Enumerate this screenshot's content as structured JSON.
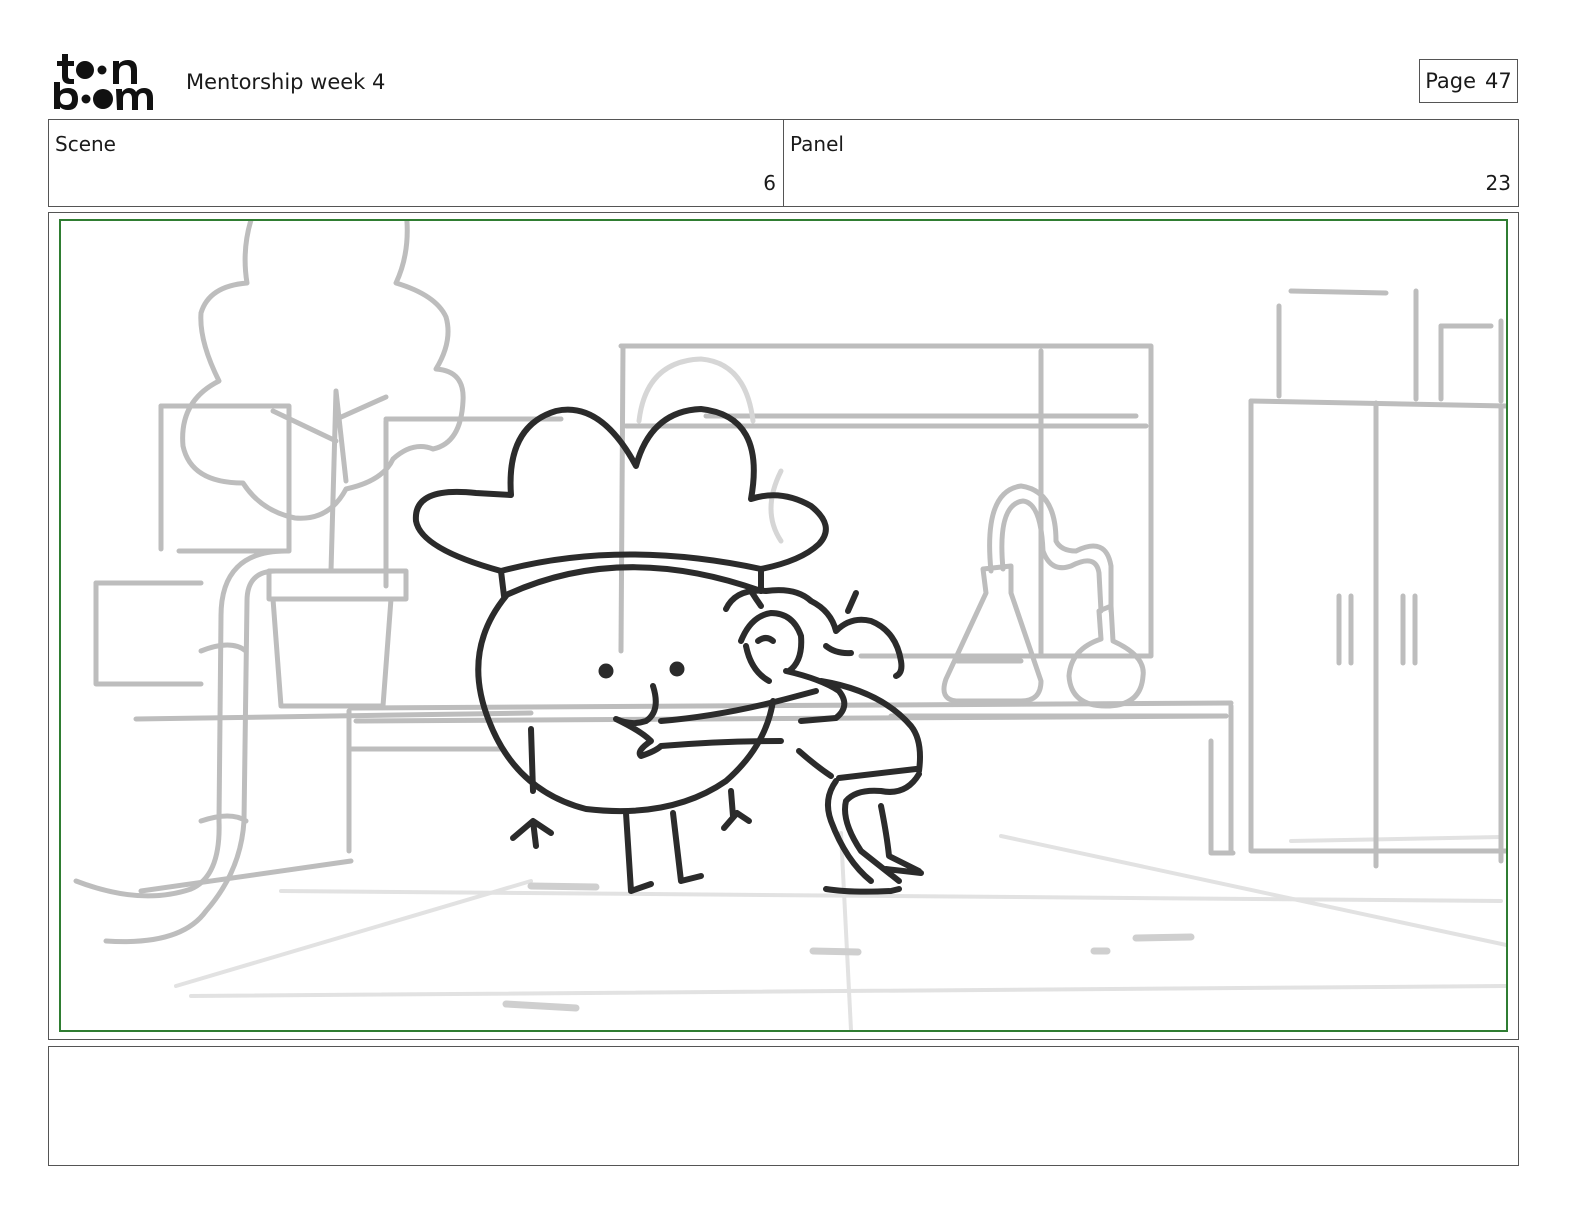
{
  "header": {
    "logo_text": "toon boom",
    "project_title": "Mentorship week 4",
    "page_label": "Page",
    "page_number": "47"
  },
  "info": {
    "scene_label": "Scene",
    "scene_value": "6",
    "panel_label": "Panel",
    "panel_value": "23"
  },
  "panel": {
    "safe_frame_color": "#2f7d32",
    "background_line_color": "#bdbdbd",
    "character_line_color": "#2b2b2b"
  },
  "notes": {
    "text": ""
  }
}
